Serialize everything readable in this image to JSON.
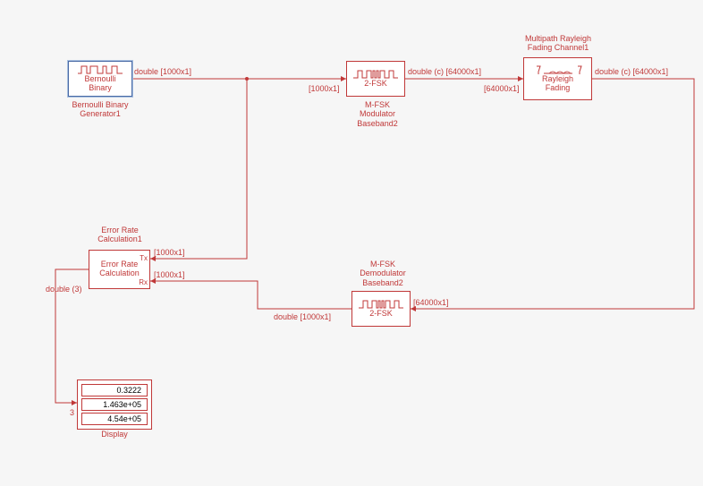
{
  "blocks": {
    "bernoulli": {
      "title_line1": "Bernoulli",
      "title_line2": "Binary",
      "label": "Bernoulli Binary\nGenerator1",
      "out_sig": "double [1000x1]"
    },
    "modulator": {
      "inner": "2-FSK",
      "label": "M-FSK\nModulator\nBaseband2",
      "in_sig": "[1000x1]",
      "out_sig": "double (c) [64000x1]"
    },
    "channel": {
      "inner_line1": "Rayleigh",
      "inner_line2": "Fading",
      "label": "Multipath Rayleigh\nFading Channel1",
      "in_sig": "[64000x1]",
      "out_sig": "double (c) [64000x1]"
    },
    "demodulator": {
      "inner": "2-FSK",
      "label": "M-FSK\nDemodulator\nBaseband2",
      "in_sig": "[64000x1]",
      "out_sig": "double [1000x1]"
    },
    "errorrate": {
      "inner_line1": "Error Rate",
      "inner_line2": "Calculation",
      "label": "Error Rate\nCalculation1",
      "port_tx": "Tx",
      "port_rx": "Rx",
      "tx_sig": "[1000x1]",
      "rx_sig": "[1000x1]",
      "out_sig": "double (3)"
    },
    "display": {
      "label": "Display",
      "val1": "0.3222",
      "val2": "1.463e+05",
      "val3": "4.54e+05",
      "in_sig": "3"
    }
  },
  "colors": {
    "line": "#c03838"
  }
}
